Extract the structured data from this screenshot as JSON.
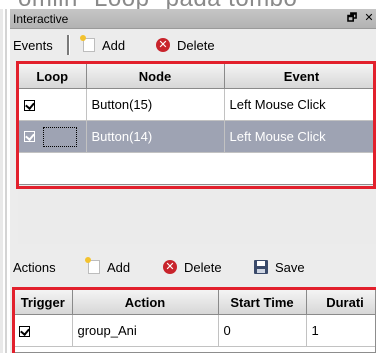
{
  "doc_overlay": {
    "text": "omiin \"Loop\" pada tombo"
  },
  "window": {
    "title": "Interactive",
    "restore_icon": "restore-icon",
    "close_icon": "close-icon",
    "restore_glyph": "🗗",
    "close_glyph": "✕"
  },
  "events_toolbar": {
    "label": "Events",
    "add_label": "Add",
    "delete_label": "Delete"
  },
  "events_table": {
    "columns": [
      "Loop",
      "Node",
      "Event"
    ],
    "rows": [
      {
        "loop": true,
        "node": "Button(15)",
        "event": "Left Mouse Click",
        "selected": false
      },
      {
        "loop": true,
        "node": "Button(14)",
        "event": "Left Mouse Click",
        "selected": true
      }
    ]
  },
  "actions_toolbar": {
    "label": "Actions",
    "add_label": "Add",
    "delete_label": "Delete",
    "save_label": "Save"
  },
  "actions_table": {
    "columns": [
      "Trigger",
      "Action",
      "Start Time",
      "Durati"
    ],
    "rows": [
      {
        "trigger": true,
        "action": "group_Ani",
        "start_time": "0",
        "duration": "1"
      }
    ]
  },
  "colors": {
    "highlight_border": "#e2202c",
    "selected_row": "#9ea3b3",
    "titlebar": "#c0c0c0"
  }
}
